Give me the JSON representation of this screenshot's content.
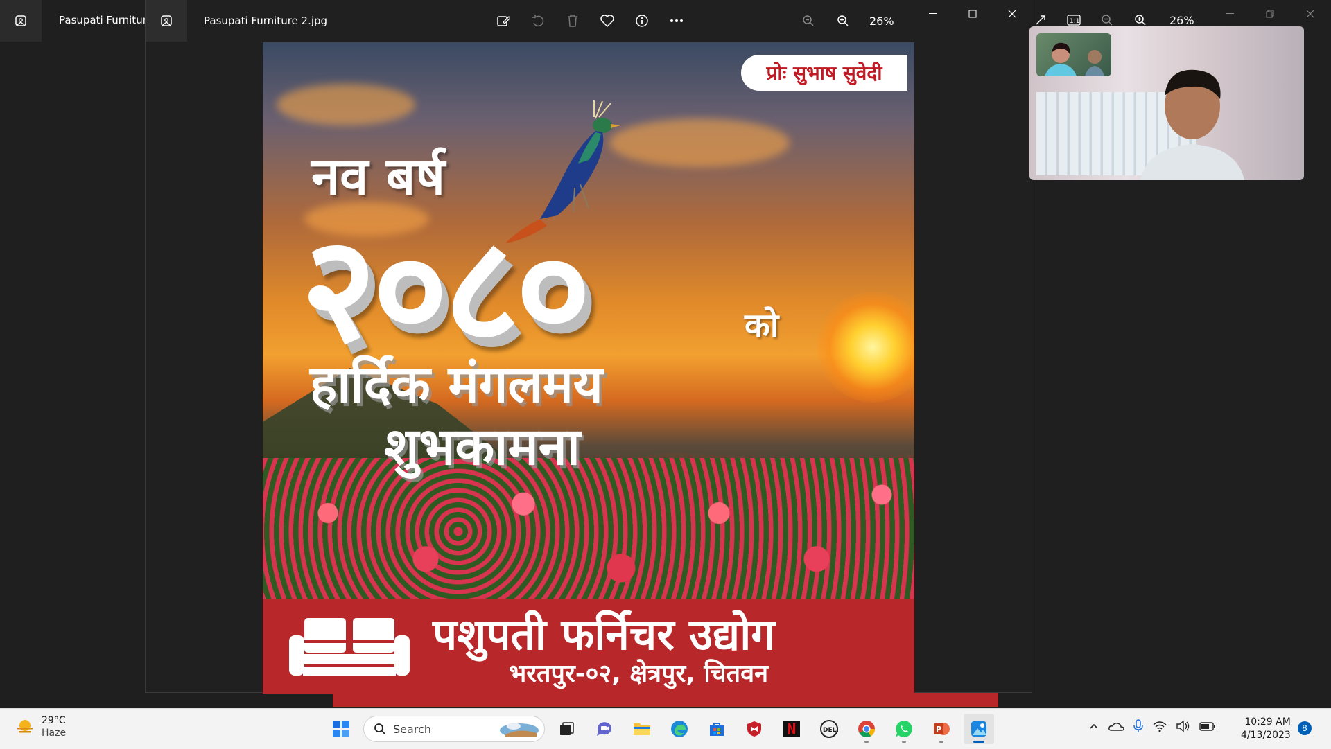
{
  "background_window": {
    "title": "Pasupati Furniture",
    "zoom": "26%"
  },
  "window": {
    "title": "Pasupati Furniture 2.jpg",
    "zoom": "26%",
    "toolbar": [
      "edit-image",
      "rotate",
      "delete",
      "favorite",
      "file-info",
      "more-options"
    ]
  },
  "poster": {
    "proprietor": "प्रोः सुभाष सुवेदी",
    "headline": "नव बर्ष",
    "year": "२०८०",
    "suffix": "को",
    "greeting_line1": "हार्दिक मंगलमय",
    "greeting_line2": "शुभकामना",
    "company": "पशुपती फर्निचर उद्योग",
    "address": "भरतपुर-०२, क्षेत्रपुर, चितवन"
  },
  "taskbar": {
    "weather_temp": "29°C",
    "weather_condition": "Haze",
    "search_label": "Search",
    "time": "10:29 AM",
    "date": "4/13/2023",
    "notification_count": "8",
    "apps": [
      "start",
      "search",
      "task-view",
      "teams-chat",
      "file-explorer",
      "edge",
      "microsoft-store",
      "mcafee",
      "netflix",
      "dell",
      "chrome",
      "whatsapp",
      "powerpoint",
      "photos"
    ]
  },
  "colors": {
    "banner_red": "#b8282a",
    "taskbar": "#f3f3f3",
    "window_bg": "#202020",
    "accent": "#005fb8"
  }
}
